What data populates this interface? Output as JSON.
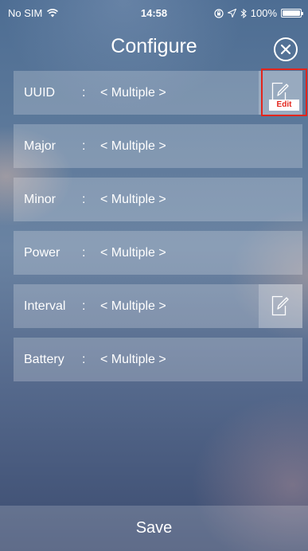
{
  "status_bar": {
    "carrier": "No SIM",
    "time": "14:58",
    "battery": "100%"
  },
  "nav": {
    "title": "Configure"
  },
  "rows": [
    {
      "label": "UUID",
      "colon": ":",
      "value": "< Multiple >"
    },
    {
      "label": "Major",
      "colon": ":",
      "value": "< Multiple >"
    },
    {
      "label": "Minor",
      "colon": ":",
      "value": "< Multiple >"
    },
    {
      "label": "Power",
      "colon": ":",
      "value": "< Multiple >"
    },
    {
      "label": "Interval",
      "colon": ":",
      "value": "< Multiple >"
    },
    {
      "label": "Battery",
      "colon": ":",
      "value": "< Multiple >"
    }
  ],
  "annotation": {
    "caption": "Edit",
    "color": "#e3251c"
  },
  "footer": {
    "save_label": "Save"
  },
  "icons": {
    "close": "close-icon",
    "edit": "edit-pencil-icon",
    "wifi": "wifi-icon",
    "lock_rotation": "lock-rotation-icon",
    "location": "location-icon",
    "bluetooth": "bluetooth-icon",
    "battery": "battery-icon"
  }
}
